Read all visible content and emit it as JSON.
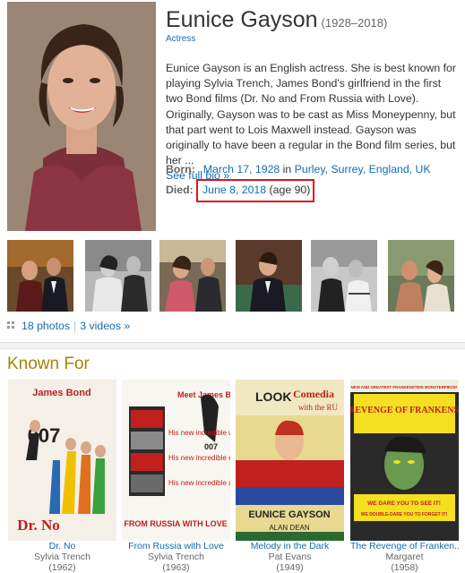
{
  "profile": {
    "name": "Eunice Gayson",
    "years": "(1928–2018)",
    "job": "Actress",
    "bio": "Eunice Gayson is an English actress. She is best known for playing Sylvia Trench, James Bond's girlfriend in the first two Bond films (Dr. No and From Russia with Love). Originally, Gayson was to be cast as Miss Moneypenny, but that part went to Lois Maxwell instead. Gayson was originally to have been a regular in the Bond film series, but her ...",
    "see_full_bio": "See full bio »",
    "born_label": "Born:",
    "born_date": "March 17, 1928",
    "born_in": "in",
    "born_place": "Purley, Surrey, England, UK",
    "died_label": "Died:",
    "died_date": "June 8, 2018",
    "died_age": "(age 90)"
  },
  "media": {
    "photos": "18 photos",
    "separator": "|",
    "videos": "3 videos »"
  },
  "known_for": {
    "title": "Known For",
    "items": [
      {
        "title": "Dr. No",
        "role": "Sylvia Trench",
        "year": "(1962)",
        "poster_text": [
          "James Bond",
          "007",
          "Dr. No"
        ]
      },
      {
        "title": "From Russia with Love",
        "role": "Sylvia Trench",
        "year": "(1963)",
        "poster_text": [
          "Meet James Bond,",
          "007",
          "His new incredible women...",
          "His new incredible enemies...",
          "His new incredible adventures...",
          "FROM RUSSIA WITH LOVE"
        ]
      },
      {
        "title": "Melody in the Dark",
        "role": "Pat Evans",
        "year": "(1949)",
        "poster_text": [
          "LOOK",
          "Comedia",
          "with the RU",
          "EUNICE GAYSON",
          "ALAN DEAN"
        ]
      },
      {
        "title": "The Revenge of Franken...",
        "role": "Margaret",
        "year": "(1958)",
        "poster_text": [
          "NEW AND GREATEST FRANKENSTEIN MONSTERPIECE!",
          "THE REVENGE OF FRANKENSTEIN",
          "WE DARE YOU TO SEE IT!",
          "WE DOUBLE-DARE YOU TO FORGET IT!"
        ]
      }
    ]
  },
  "colors": {
    "link": "#136cb2",
    "heading": "#a58500",
    "highlight": "#e0111b"
  }
}
